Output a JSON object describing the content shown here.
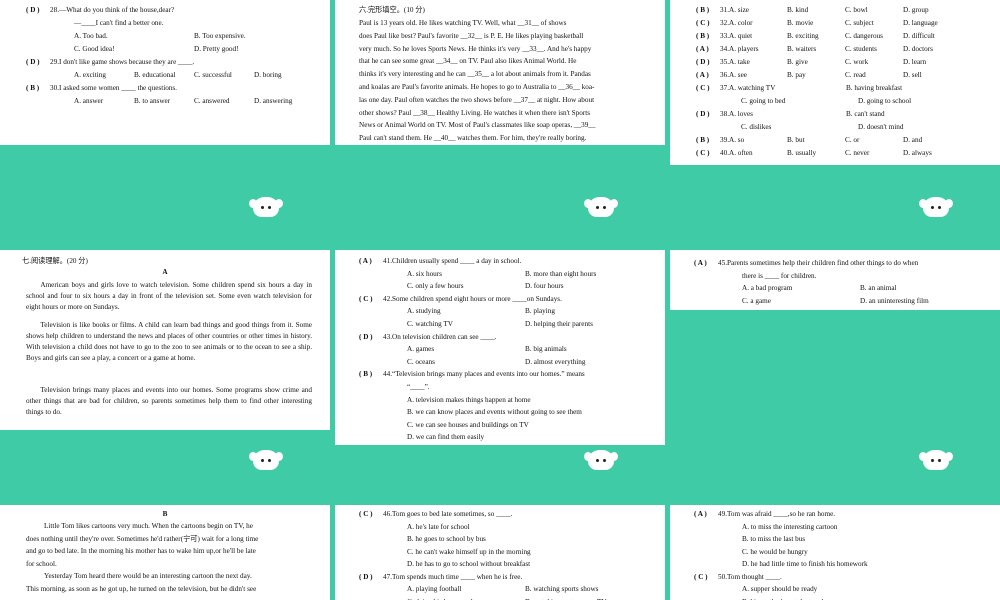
{
  "p1": [
    {
      "paren": "( D )",
      "num": "28.",
      "q": "—What do you think of the house,dear?"
    },
    {
      "line": "—____I can't find a better one."
    },
    {
      "opts": [
        "A. Too bad.",
        "B. Too expensive."
      ]
    },
    {
      "opts": [
        "C. Good idea!",
        "D. Pretty good!"
      ]
    },
    {
      "paren": "( D )",
      "num": "29.",
      "q": "I don't like game shows because they are ____."
    },
    {
      "opts4": [
        "A. exciting",
        "B. educational",
        "C. successful",
        "D. boring"
      ]
    },
    {
      "paren": "( B )",
      "num": "30.",
      "q": "I asked some women ____ the questions."
    },
    {
      "opts4": [
        "A. answer",
        "B. to answer",
        "C. answered",
        "D. answering"
      ]
    }
  ],
  "p2": {
    "heading": "六.完形填空。(10 分)",
    "lines": [
      "Paul is 13 years old. He likes watching TV. Well, what __31__ of shows",
      "does Paul like best? Paul's favorite __32__ is P. E. He likes playing basketball",
      "very much. So he loves Sports News. He thinks it's very __33__. And he's happy",
      "that he can see some great __34__ on TV. Paul also likes Animal World. He",
      "thinks it's very interesting and he can __35__ a lot about animals from it. Pandas",
      "and koalas are Paul's favorite animals. He hopes to go to Australia to __36__ koa-",
      "las one day. Paul often watches the two shows before __37__ at night. How about",
      "other shows? Paul __38__ Healthy Living. He watches it when there isn't Sports",
      "News or Animal World on TV. Most of Paul's classmates like soap operas, __39__",
      "Paul can't stand them. He __40__ watches them. For him, they're really boring."
    ]
  },
  "p3": [
    {
      "paren": "( B )",
      "num": "31.",
      "opts": [
        "A. size",
        "B. kind",
        "C. bowl",
        "D. group"
      ]
    },
    {
      "paren": "( C )",
      "num": "32.",
      "opts": [
        "A. color",
        "B. movie",
        "C. subject",
        "D. language"
      ]
    },
    {
      "paren": "( B )",
      "num": "33.",
      "opts": [
        "A. quiet",
        "B. exciting",
        "C. dangerous",
        "D. difficult"
      ]
    },
    {
      "paren": "( A )",
      "num": "34.",
      "opts": [
        "A. players",
        "B. waiters",
        "C. students",
        "D. doctors"
      ]
    },
    {
      "paren": "( D )",
      "num": "35.",
      "opts": [
        "A. take",
        "B. give",
        "C. work",
        "D. learn"
      ]
    },
    {
      "paren": "( A )",
      "num": "36.",
      "opts": [
        "A. see",
        "B. pay",
        "C. read",
        "D. sell"
      ]
    },
    {
      "paren": "( C )",
      "num": "37.",
      "opts2": [
        "A. watching TV",
        "B. having breakfast"
      ]
    },
    {
      "opts2": [
        "C. going to bed",
        "D. going to school"
      ]
    },
    {
      "paren": "( D )",
      "num": "38.",
      "opts2": [
        "A. loves",
        "B. can't stand"
      ]
    },
    {
      "opts2": [
        "C. dislikes",
        "D. doesn't mind"
      ]
    },
    {
      "paren": "( B )",
      "num": "39.",
      "opts": [
        "A. so",
        "B. but",
        "C. or",
        "D. and"
      ]
    },
    {
      "paren": "( C )",
      "num": "40.",
      "opts": [
        "A. often",
        "B. usually",
        "C. never",
        "D. always"
      ]
    }
  ],
  "p4": {
    "heading": "七.阅读理解。(20 分)",
    "sub": "A",
    "paras": [
      "American boys and girls love to watch television. Some children spend six hours a day in school and four to six hours a day in front of the television set. Some even watch television for eight hours or more on Sundays.",
      "Television is like books or films. A child can learn bad things and good things from it. Some shows help children to understand the news and places of other countries or other times in history. With television a child does not have to go to the zoo to see animals or to the ocean to see a ship. Boys and girls can see a play, a concert or a game at home.",
      "Television brings many places and events into our homes. Some programs show crime and other things that are bad for children, so parents sometimes help them to find other interesting things to do."
    ]
  },
  "p5": [
    {
      "paren": "( A )",
      "num": "41.",
      "q": "Children usually spend ____ a day in school."
    },
    {
      "opts2": [
        "A. six hours",
        "B. more than eight hours"
      ]
    },
    {
      "opts2": [
        "C. only a few hours",
        "D. four hours"
      ]
    },
    {
      "paren": "( C )",
      "num": "42.",
      "q": "Some children spend eight hours or more ____on Sundays."
    },
    {
      "opts2": [
        "A. studying",
        "B. playing"
      ]
    },
    {
      "opts2": [
        "C. watching TV",
        "D. helping their parents"
      ]
    },
    {
      "paren": "( D )",
      "num": "43.",
      "q": "On television children can see ____."
    },
    {
      "opts2": [
        "A. games",
        "B. big animals"
      ]
    },
    {
      "opts2": [
        "C. oceans",
        "D. almost everything"
      ]
    },
    {
      "paren": "( B )",
      "num": "44.",
      "q": "“Television brings many places and events into our homes.” means"
    },
    {
      "line": "“____”."
    },
    {
      "line": "A. television makes things happen at home"
    },
    {
      "line": "B. we can know places and events without going to see them"
    },
    {
      "line": "C. we can see houses and buildings on TV"
    },
    {
      "line": "D. we can find them easily"
    }
  ],
  "p6": [
    {
      "paren": "( A )",
      "num": "45.",
      "q": "Parents sometimes help their children find other things to do when"
    },
    {
      "line": "there is ____ for children."
    },
    {
      "opts2": [
        "A. a bad program",
        "B. an animal"
      ]
    },
    {
      "opts2": [
        "C. a game",
        "D. an uninteresting film"
      ]
    }
  ],
  "p7": {
    "sub": "B",
    "lines": [
      "Little Tom likes cartoons very much. When the cartoons begin on TV, he",
      "does nothing until they're over. Sometimes he'd rather(宁可) wait for a long time",
      "and go to bed late. In the morning his mother has to wake him up,or he'll be late",
      "for school.",
      "Yesterday Tom heard there would be an interesting cartoon the next day.",
      "This morning, as soon as he got up, he turned on the television, but he didn't see"
    ]
  },
  "p8": [
    {
      "paren": "( C )",
      "num": "46.",
      "q": "Tom goes to bed late sometimes, so ____."
    },
    {
      "line": "A. he's late for school"
    },
    {
      "line": "B. he goes to school by bus"
    },
    {
      "line": "C. he can't wake himself up in the morning"
    },
    {
      "line": "D. he has to go to school without breakfast"
    },
    {
      "paren": "( D )",
      "num": "47.",
      "q": "Tom spends much time ____ when he is free."
    },
    {
      "opts2": [
        "A. playing football",
        "B. watching sports shows"
      ]
    },
    {
      "opts2": [
        "C. doing his homework",
        "D. watching cartoons on TV"
      ]
    }
  ],
  "p9": [
    {
      "paren": "( A )",
      "num": "49.",
      "q": "Tom was afraid ____,so he ran home."
    },
    {
      "line": "A. to miss the interesting cartoon"
    },
    {
      "line": "B. to miss the last bus"
    },
    {
      "line": "C. he would be hungry"
    },
    {
      "line": "D. he had little time to finish his homework"
    },
    {
      "paren": "( C )",
      "num": "50.",
      "q": "Tom thought ____."
    },
    {
      "line": "A. supper should be ready"
    },
    {
      "line": "B. his mother's watch was slow"
    }
  ],
  "icons": {
    "mascot": "sheep-mascot-icon"
  }
}
